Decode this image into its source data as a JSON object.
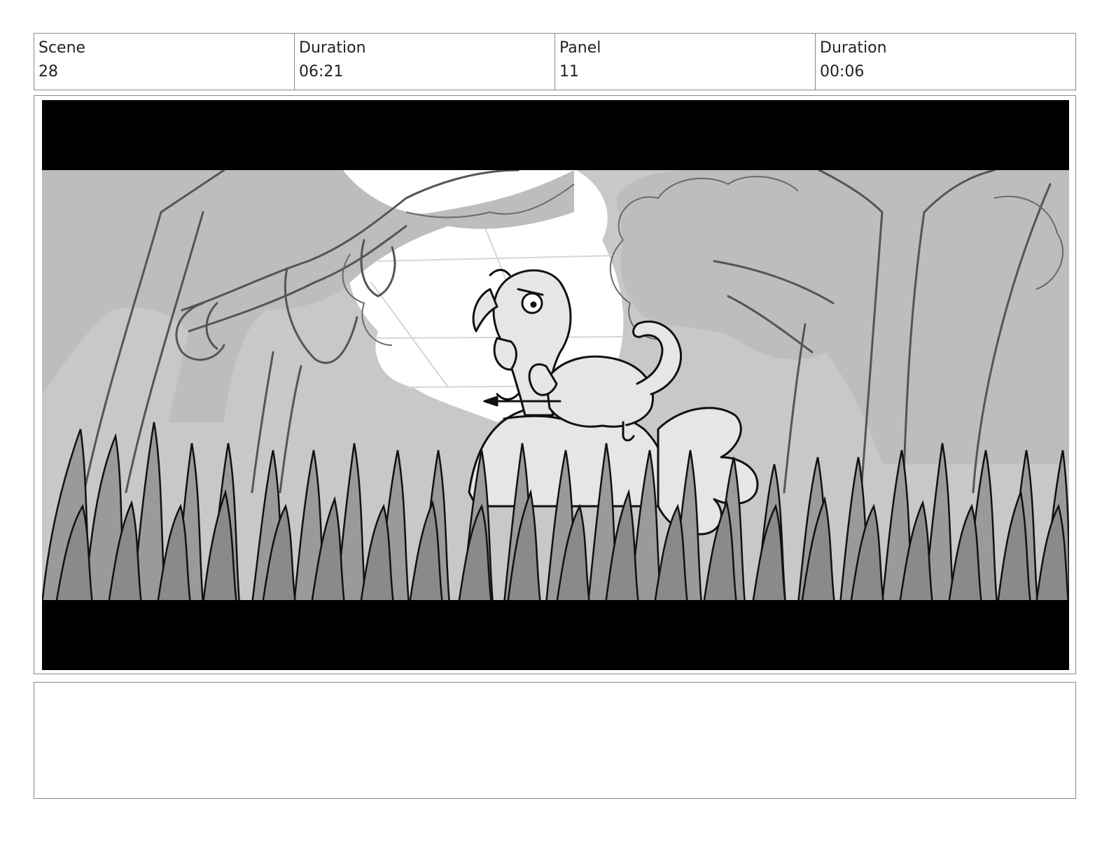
{
  "header": {
    "scene_label": "Scene",
    "scene_value": "28",
    "scene_duration_label": "Duration",
    "scene_duration_value": "06:21",
    "panel_label": "Panel",
    "panel_value": "11",
    "panel_duration_label": "Duration",
    "panel_duration_value": "00:06"
  },
  "notes": {
    "text": ""
  }
}
